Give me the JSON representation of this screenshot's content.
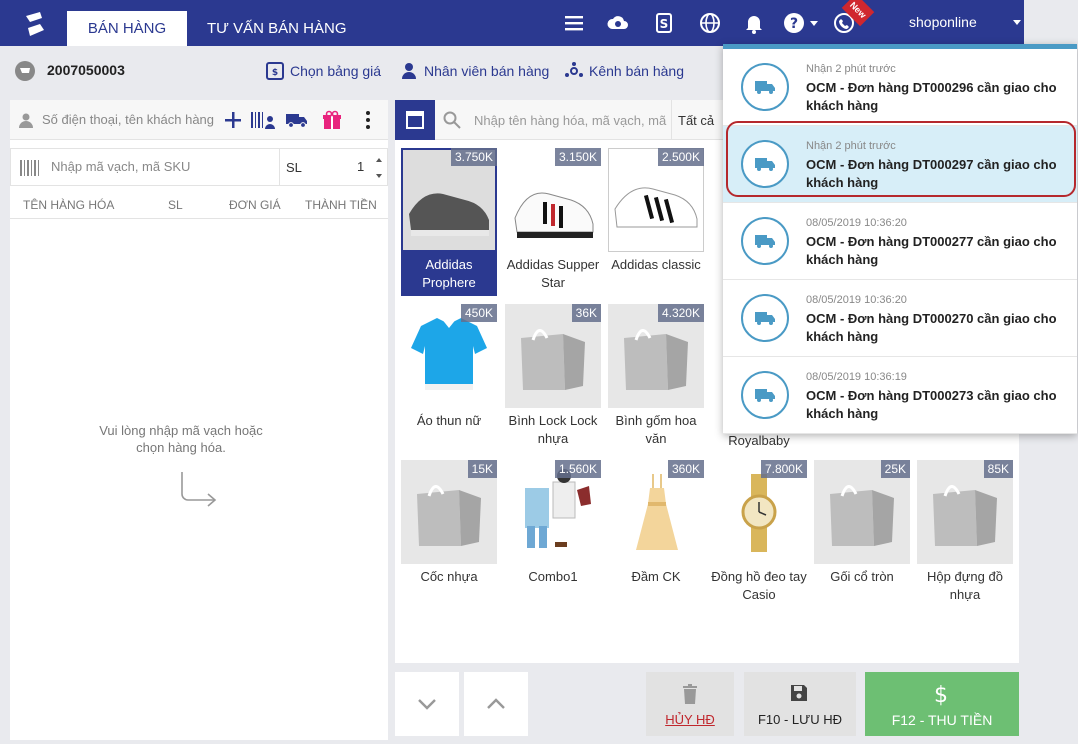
{
  "header": {
    "tabs": [
      {
        "label": "BÁN HÀNG",
        "active": true
      },
      {
        "label": "TƯ VẤN BÁN HÀNG",
        "active": false
      }
    ],
    "new_badge": "New",
    "username": "shoponline",
    "brand_color": "#2b3990"
  },
  "subbar": {
    "order_code": "2007050003",
    "price_list_label": "Chọn bảng giá",
    "staff_label": "Nhân viên bán hàng",
    "channel_label": "Kênh bán hàng"
  },
  "left": {
    "customer_placeholder": "Số điện thoại, tên khách hàng",
    "sku_placeholder": "Nhập mã vạch, mã SKU",
    "qty_label": "SL",
    "qty_value": "1",
    "columns": [
      "TÊN HÀNG HÓA",
      "SL",
      "ĐƠN GIÁ",
      "THÀNH TIỀN"
    ],
    "empty_message": "Vui lòng nhập mã vạch hoặc chọn hàng hóa."
  },
  "right": {
    "search_placeholder": "Nhập tên hàng hóa, mã vạch, mã",
    "filter_label": "Tất cả",
    "products": [
      {
        "name": "Addidas Prophere",
        "price": "3.750K",
        "icon": "shoe-icon"
      },
      {
        "name": "Addidas Supper Star",
        "price": "3.150K",
        "icon": "shoe-icon"
      },
      {
        "name": "Addidas classic",
        "price": "2.500K",
        "icon": "shoe-icon"
      },
      {
        "name": "Áo thun nữ",
        "price": "450K",
        "icon": "tshirt-icon"
      },
      {
        "name": "Bình Lock Lock nhựa",
        "price": "36K",
        "icon": "bag-icon"
      },
      {
        "name": "Bình gốm hoa văn",
        "price": "4.320K",
        "icon": "bag-icon"
      },
      {
        "name": "Royalbaby",
        "price": "",
        "icon": "bag-icon"
      },
      {
        "name": "Cốc nhựa",
        "price": "15K",
        "icon": "bag-icon"
      },
      {
        "name": "Combo1",
        "price": "1.560K",
        "icon": "clothes-icon"
      },
      {
        "name": "Đầm CK",
        "price": "360K",
        "icon": "dress-icon"
      },
      {
        "name": "Đồng hồ đeo tay Casio",
        "price": "7.800K",
        "icon": "watch-icon"
      },
      {
        "name": "Gối cổ tròn",
        "price": "25K",
        "icon": "bag-icon"
      },
      {
        "name": "Hộp đựng đồ nhựa",
        "price": "85K",
        "icon": "bag-icon"
      }
    ]
  },
  "footer": {
    "cancel_label": "HỦY HĐ",
    "save_label": "F10 - LƯU HĐ",
    "pay_label": "F12 - THU TIỀN"
  },
  "notifications": [
    {
      "time": "Nhận 2 phút trước",
      "text": "OCM - Đơn hàng DT000296 cần giao cho khách hàng",
      "highlight": false
    },
    {
      "time": "Nhận 2 phút trước",
      "text": "OCM - Đơn hàng DT000297 cần giao cho khách hàng",
      "highlight": true
    },
    {
      "time": "08/05/2019 10:36:20",
      "text": "OCM - Đơn hàng DT000277 cần giao cho khách hàng",
      "highlight": false
    },
    {
      "time": "08/05/2019 10:36:20",
      "text": "OCM - Đơn hàng DT000270 cần giao cho khách hàng",
      "highlight": false
    },
    {
      "time": "08/05/2019 10:36:19",
      "text": "OCM - Đơn hàng DT000273 cần giao cho khách hàng",
      "highlight": false
    }
  ]
}
